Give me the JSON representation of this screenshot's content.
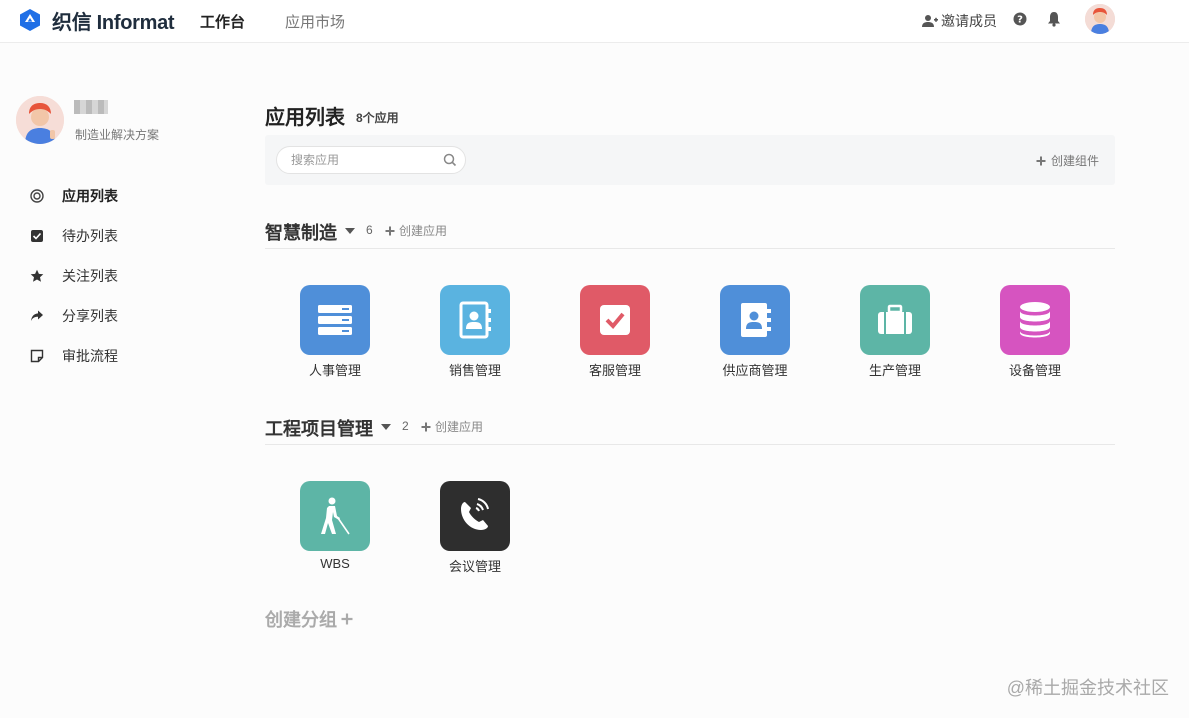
{
  "header": {
    "brand": "织信 Informat",
    "nav": [
      "工作台",
      "应用市场"
    ],
    "invite_label": "邀请成员",
    "icons": [
      "logo-icon",
      "add-user-icon",
      "help-icon",
      "bell-icon",
      "avatar"
    ]
  },
  "profile": {
    "subtitle": "制造业解决方案"
  },
  "sidebar": {
    "items": [
      {
        "label": "应用列表",
        "icon": "target-icon",
        "active": true
      },
      {
        "label": "待办列表",
        "icon": "checkbox-icon",
        "active": false
      },
      {
        "label": "关注列表",
        "icon": "star-icon",
        "active": false
      },
      {
        "label": "分享列表",
        "icon": "share-icon",
        "active": false
      },
      {
        "label": "审批流程",
        "icon": "note-icon",
        "active": false
      }
    ]
  },
  "main": {
    "title": "应用列表",
    "count": "8个应用",
    "search_placeholder": "搜索应用",
    "create_widget": "创建组件",
    "groups": [
      {
        "name": "智慧制造",
        "count": "6",
        "create": "创建应用",
        "apps": [
          {
            "label": "人事管理",
            "icon": "server-icon",
            "color": "#4f8fd9"
          },
          {
            "label": "销售管理",
            "icon": "contact-book-icon",
            "color": "#5ab3e0"
          },
          {
            "label": "客服管理",
            "icon": "checkbox-icon",
            "color": "#e05a67"
          },
          {
            "label": "供应商管理",
            "icon": "address-book-icon",
            "color": "#4f8fd9"
          },
          {
            "label": "生产管理",
            "icon": "briefcase-icon",
            "color": "#5db5a6"
          },
          {
            "label": "设备管理",
            "icon": "database-icon",
            "color": "#d654c0"
          }
        ]
      },
      {
        "name": "工程项目管理",
        "count": "2",
        "create": "创建应用",
        "apps": [
          {
            "label": "WBS",
            "icon": "blind-walker-icon",
            "color": "#5db5a6"
          },
          {
            "label": "会议管理",
            "icon": "phone-call-icon",
            "color": "#2e2e2e"
          }
        ]
      }
    ],
    "create_group": "创建分组"
  },
  "watermark": "@稀土掘金技术社区"
}
